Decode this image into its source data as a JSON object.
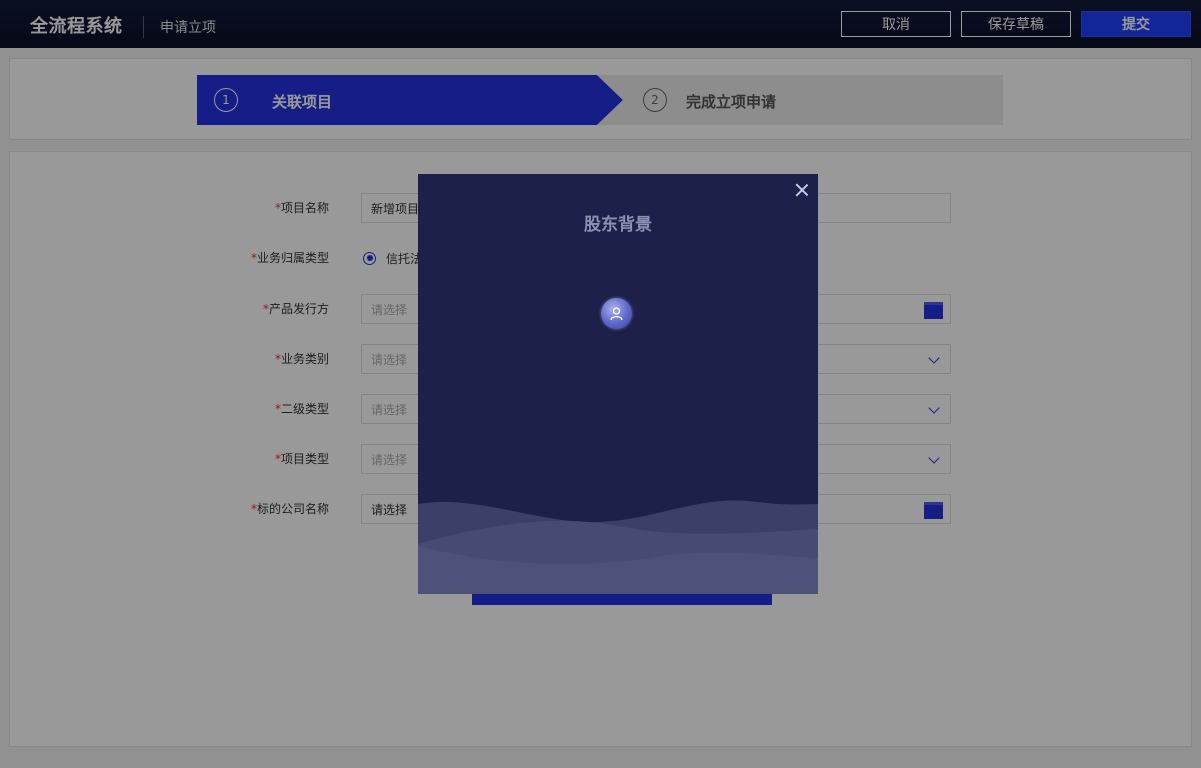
{
  "header": {
    "app_title": "全流程系统",
    "page_crumb": "申请立项",
    "cancel_label": "取消",
    "draft_label": "保存草稿",
    "submit_label": "提交"
  },
  "steps": [
    {
      "num": "1",
      "label": "关联项目",
      "active": true
    },
    {
      "num": "2",
      "label": "完成立项申请",
      "active": false
    }
  ],
  "form": {
    "required_mark": "*",
    "project_name": {
      "label": "项目名称",
      "value": "新增项目"
    },
    "business_type": {
      "label": "业务归属类型",
      "option": "信托法"
    },
    "issuer": {
      "label": "产品发行方",
      "placeholder": "请选择"
    },
    "business_category": {
      "label": "业务类别",
      "placeholder": "请选择"
    },
    "secondary_type": {
      "label": "二级类型",
      "placeholder": "请选择"
    },
    "project_type": {
      "label": "项目类型",
      "placeholder": "请选择"
    },
    "target_company": {
      "label": "标的公司名称",
      "value": "请选择"
    }
  },
  "modal": {
    "title": "股东背景"
  },
  "colors": {
    "accent": "#2433e0",
    "header_bg": "#0a0f26",
    "modal_bg": "#1d2048",
    "submit_bg": "#1f3fff",
    "required": "#ff2a2a"
  }
}
